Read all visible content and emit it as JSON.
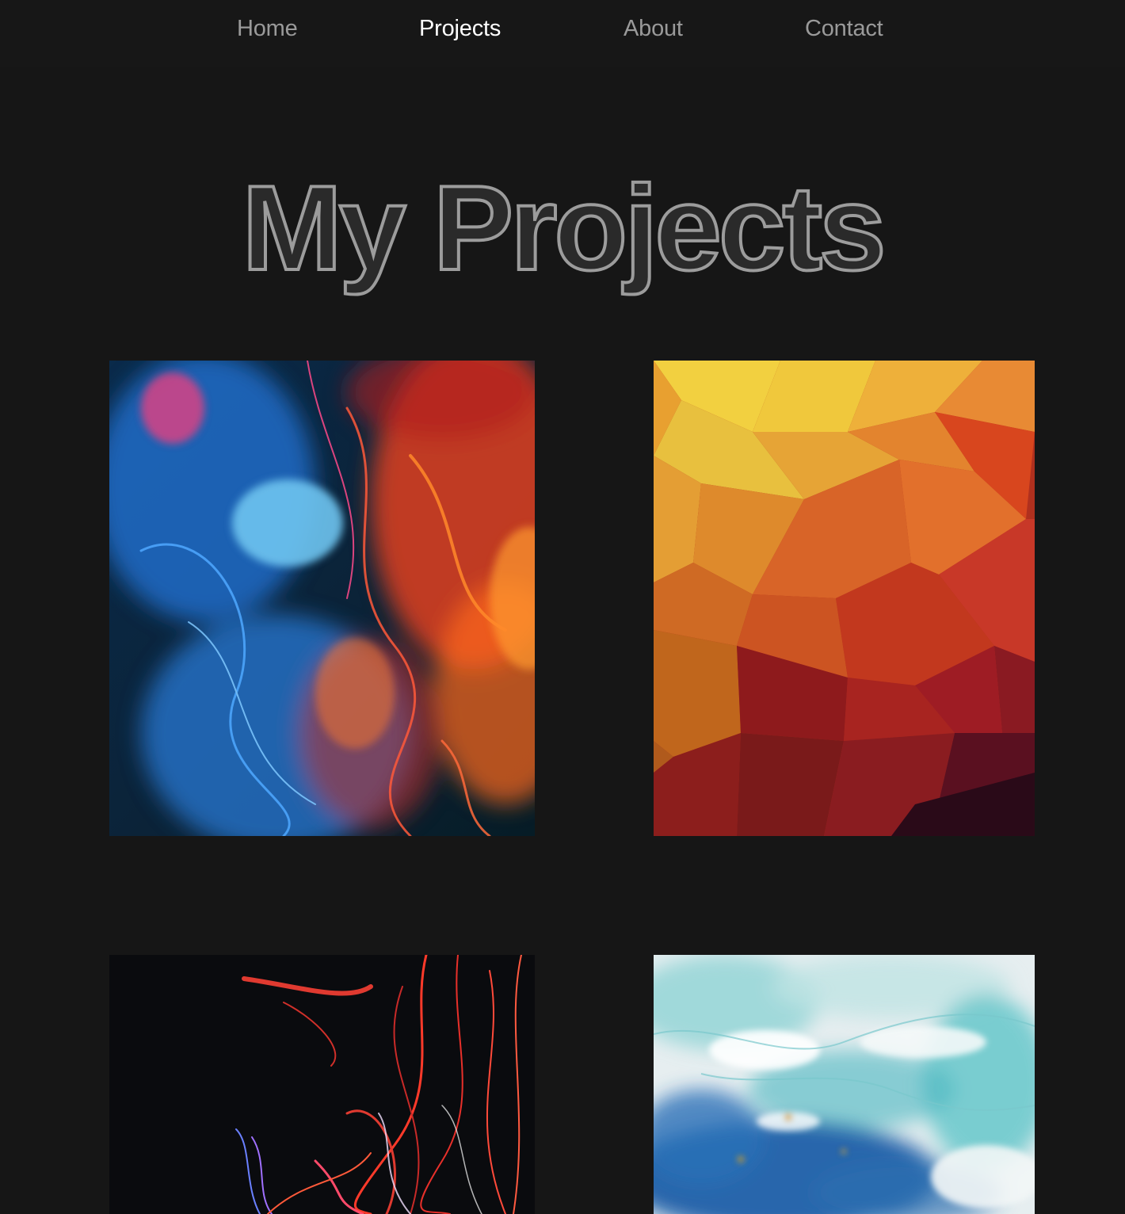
{
  "nav": {
    "items": [
      {
        "label": "Home",
        "active": false
      },
      {
        "label": "Projects",
        "active": true
      },
      {
        "label": "About",
        "active": false
      },
      {
        "label": "Contact",
        "active": false
      }
    ]
  },
  "page": {
    "title": "My Projects"
  },
  "projects": [
    {
      "thumbnail": "blue-red-ink-smoke"
    },
    {
      "thumbnail": "orange-red-low-poly"
    },
    {
      "thumbnail": "red-light-trails"
    },
    {
      "thumbnail": "teal-white-fluid-marble"
    }
  ],
  "colors": {
    "background": "#161616",
    "nav_text": "#9a9a9a",
    "nav_active": "#ffffff",
    "title_fill": "#2a2a2a",
    "title_stroke": "#9c9c9c"
  }
}
